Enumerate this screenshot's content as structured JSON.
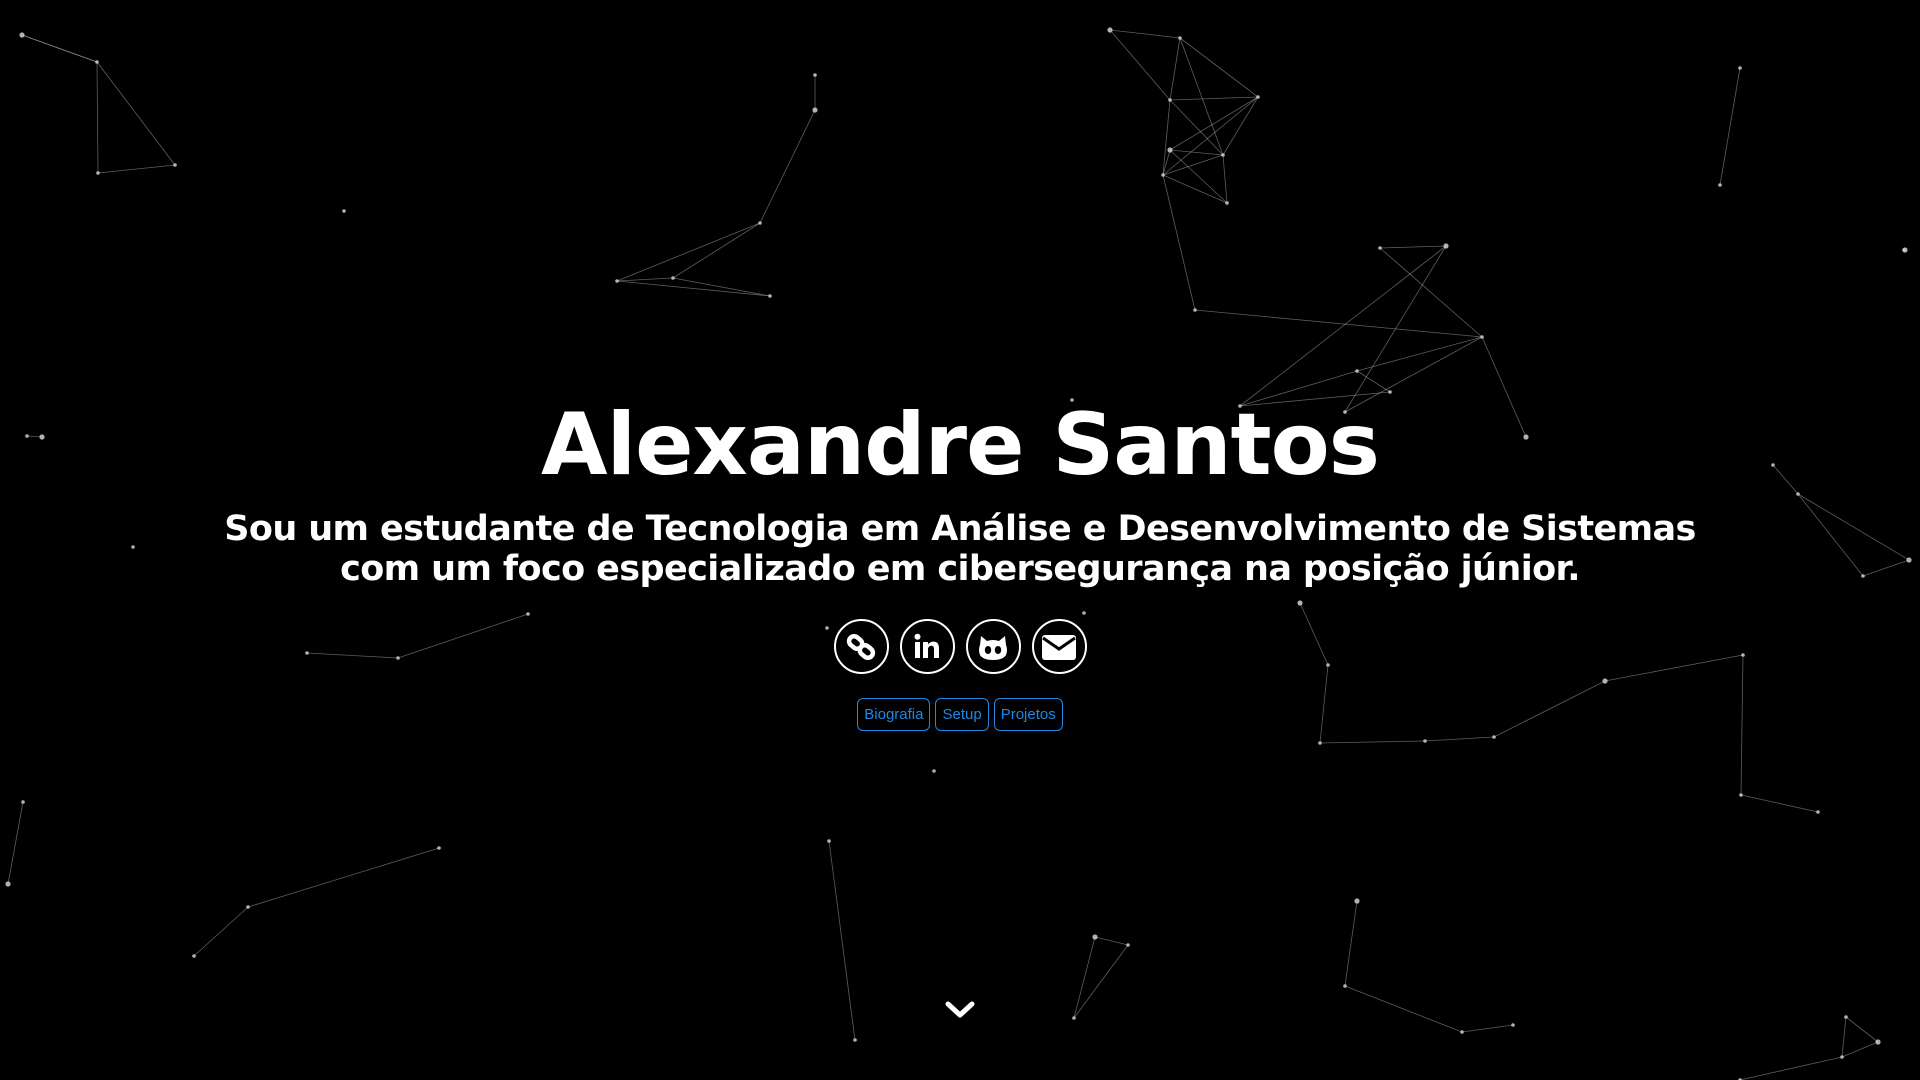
{
  "hero": {
    "name": "Alexandre Santos",
    "tagline": "Sou um estudante de Tecnologia em Análise e Desenvolvimento de Sistemas com um foco especializado em cibersegurança na posição júnior."
  },
  "social": [
    {
      "icon": "link-icon"
    },
    {
      "icon": "linkedin-icon"
    },
    {
      "icon": "github-icon"
    },
    {
      "icon": "envelope-icon"
    }
  ],
  "nav": {
    "biografia": "Biografia",
    "setup": "Setup",
    "projetos": "Projetos"
  },
  "scroll": {
    "icon": "chevron-down-icon"
  },
  "colors": {
    "background": "#000000",
    "text": "#ffffff",
    "accent": "#1e88e5",
    "particle": "#cfcfcf"
  }
}
